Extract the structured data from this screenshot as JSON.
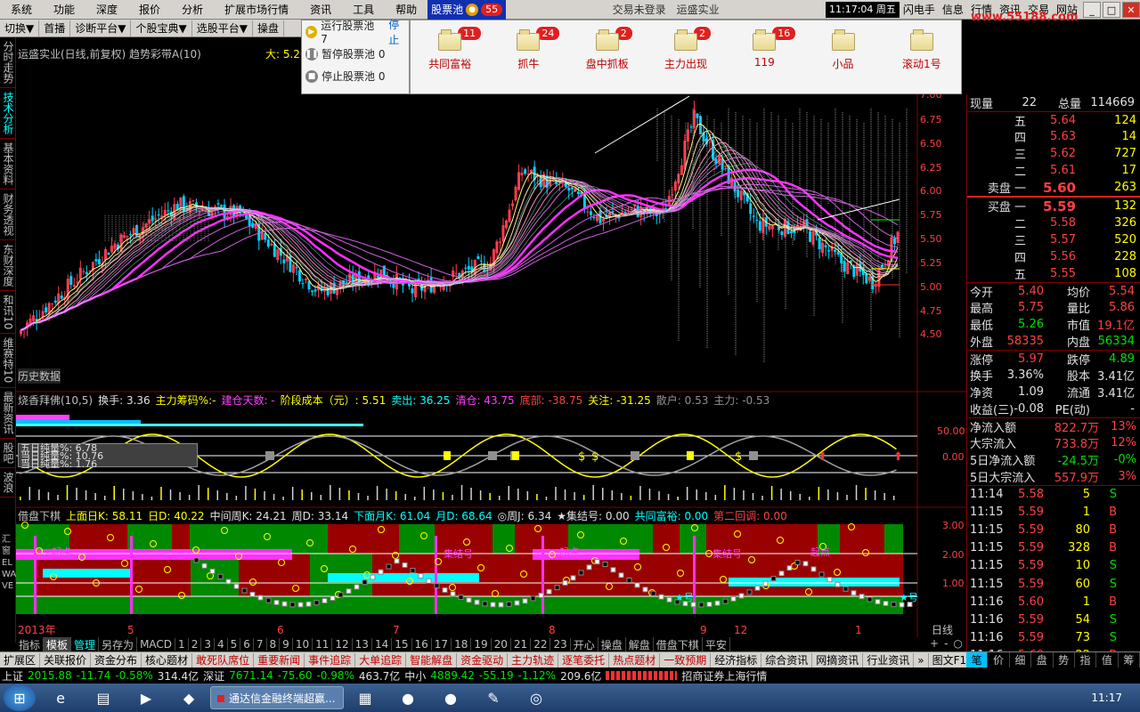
{
  "menu": {
    "items": [
      "系统",
      "功能",
      "深度",
      "报价",
      "分析",
      "扩展市场行情",
      "资讯",
      "工具",
      "帮助"
    ],
    "pool_label": "股票池",
    "pool_count": "55",
    "title": "交易未登录　运盛实业",
    "clock": "11:17:04 周五",
    "right_items": [
      "闪电手",
      "信息",
      "行情",
      "资讯",
      "交易",
      "网站"
    ],
    "site": "www.55188.com"
  },
  "toolbar": {
    "items": [
      "切换▼",
      "首播",
      "诊断平台▼",
      "个股宝典▼",
      "选股平台▼",
      "操盘"
    ]
  },
  "lefttabs": [
    "分时走势",
    "技术分析",
    "基本资料",
    "财务透视",
    "东财深度",
    "和讯10",
    "维赛特10",
    "最新资讯",
    "股吧",
    "波浪"
  ],
  "chart_header": {
    "title": "运盛实业(日线,前复权) 趋势彩带A(10)",
    "max_label": "大: 5.26",
    "data_label": "历史数据",
    "axis_prices": [
      "7.00",
      "6.75",
      "6.50",
      "6.25",
      "6.00",
      "5.75",
      "5.50",
      "5.25",
      "5.00",
      "4.75",
      "4.50"
    ]
  },
  "pool_menu": {
    "items": [
      "运行股票池 7",
      "暂停股票池 0",
      "停止股票池 0"
    ],
    "stop_label": "停止"
  },
  "pools": [
    {
      "name": "共同富裕",
      "count": "11"
    },
    {
      "name": "抓牛",
      "count": "24"
    },
    {
      "name": "盘中抓板",
      "count": "2"
    },
    {
      "name": "主力出现",
      "count": "2"
    },
    {
      "name": "119",
      "count": "16"
    },
    {
      "name": "小品",
      "count": ""
    },
    {
      "name": "滚动1号",
      "count": ""
    }
  ],
  "ind1": {
    "label": "烧香拜佛(10,5)",
    "items": [
      {
        "t": "换手: 3.36",
        "c": "wht"
      },
      {
        "t": "主力筹码%:-",
        "c": "yel"
      },
      {
        "t": "建仓天数: -",
        "c": "mag"
      },
      {
        "t": "阶段成本（元）: 5.51",
        "c": "yel"
      },
      {
        "t": "卖出: 36.25",
        "c": "cyn"
      },
      {
        "t": "清仓: 43.75",
        "c": "mag"
      },
      {
        "t": "底部: -38.75",
        "c": "red"
      },
      {
        "t": "关注: -31.25",
        "c": "yel"
      },
      {
        "t": "散户: 0.53",
        "c": "gry"
      },
      {
        "t": "主力: -0.53",
        "c": "gry"
      }
    ],
    "box": [
      "五日纯量%: 6.78",
      "当日纯量%: 10.76",
      "当日纯量%: 1.76"
    ],
    "axis": [
      "50.00",
      "0.00"
    ]
  },
  "ind2": {
    "label": "借盘下棋",
    "items": [
      {
        "t": "上面日K: 58.11",
        "c": "yel"
      },
      {
        "t": "日D: 40.22",
        "c": "yel"
      },
      {
        "t": "中间周K: 24.21",
        "c": "wht"
      },
      {
        "t": "周D: 33.14",
        "c": "wht"
      },
      {
        "t": "下面月K: 61.04",
        "c": "cyn"
      },
      {
        "t": "月D: 68.64",
        "c": "cyn"
      },
      {
        "t": "◎周J: 6.34",
        "c": "wht"
      },
      {
        "t": "★集结号: 0.00",
        "c": "wht"
      },
      {
        "t": "共同富裕: 0.00",
        "c": "cyn"
      },
      {
        "t": "第二回调: 0.00",
        "c": "red"
      }
    ],
    "axis": [
      "3.00",
      "2.00",
      "1.00"
    ],
    "left_labels": [
      "汇",
      "窗",
      "EL",
      "WA",
      "VE"
    ],
    "markers": [
      "集结号",
      "集结号",
      "起点",
      "起点",
      "起点",
      "★号",
      "★号"
    ]
  },
  "xaxis": {
    "labels": [
      "2013年",
      "5",
      "6",
      "7",
      "8",
      "9",
      "12",
      "1"
    ],
    "period": "日线"
  },
  "quote": {
    "current_label": "现量",
    "current": "22",
    "total_label": "总量",
    "total": "114669",
    "asks": [
      {
        "n": "五",
        "p": "5.64",
        "v": "124"
      },
      {
        "n": "四",
        "p": "5.63",
        "v": "14"
      },
      {
        "n": "三",
        "p": "5.62",
        "v": "727"
      },
      {
        "n": "二",
        "p": "5.61",
        "v": "17"
      },
      {
        "n": "卖盘 一",
        "p": "5.60",
        "v": "263"
      }
    ],
    "bids": [
      {
        "n": "买盘 一",
        "p": "5.59",
        "v": "132"
      },
      {
        "n": "二",
        "p": "5.58",
        "v": "326"
      },
      {
        "n": "三",
        "p": "5.57",
        "v": "520"
      },
      {
        "n": "四",
        "p": "5.56",
        "v": "228"
      },
      {
        "n": "五",
        "p": "5.55",
        "v": "108"
      }
    ],
    "stats": [
      [
        "今开",
        "5.40",
        "均价",
        "5.54"
      ],
      [
        "最高",
        "5.75",
        "量比",
        "5.86"
      ],
      [
        "最低",
        "5.26",
        "市值",
        "19.1亿"
      ],
      [
        "外盘",
        "58335",
        "内盘",
        "56334"
      ],
      [
        "涨停",
        "5.97",
        "跌停",
        "4.89"
      ],
      [
        "换手",
        "3.36%",
        "股本",
        "3.41亿"
      ],
      [
        "净资",
        "1.09",
        "流通",
        "3.41亿"
      ],
      [
        "收益(三)",
        "-0.08",
        "PE(动)",
        "-"
      ]
    ],
    "flows": [
      [
        "净流入额",
        "822.7万",
        "13%"
      ],
      [
        "大宗流入",
        "733.8万",
        "12%"
      ],
      [
        "5日净流入额",
        "-24.5万",
        "-0%"
      ],
      [
        "5日大宗流入",
        "557.9万",
        "3%"
      ]
    ],
    "ticks": [
      [
        "11:14",
        "5.58",
        "5",
        "S"
      ],
      [
        "11:15",
        "5.59",
        "1",
        "B"
      ],
      [
        "11:15",
        "5.59",
        "80",
        "B"
      ],
      [
        "11:15",
        "5.59",
        "328",
        "B"
      ],
      [
        "11:15",
        "5.59",
        "10",
        "S"
      ],
      [
        "11:15",
        "5.59",
        "60",
        "S"
      ],
      [
        "11:16",
        "5.60",
        "1",
        "B"
      ],
      [
        "11:16",
        "5.59",
        "54",
        "S"
      ],
      [
        "11:16",
        "5.59",
        "73",
        "S"
      ],
      [
        "11:16",
        "5.60",
        "22",
        "B"
      ]
    ]
  },
  "btabs1": [
    "指标",
    "模板",
    "管理",
    "另存为",
    "MACD",
    "1",
    "2",
    "3",
    "4",
    "5",
    "6",
    "7",
    "8",
    "9",
    "10",
    "11",
    "12",
    "13",
    "14",
    "15",
    "16",
    "17",
    "18",
    "19",
    "20",
    "21",
    "22",
    "23",
    "开心",
    "操盘",
    "解盘",
    "借盘下棋",
    "平安"
  ],
  "btabs2": [
    "扩展区",
    "关联报价",
    "资金分布",
    "核心题材",
    "敢死队席位",
    "重要新闻",
    "事件追踪",
    "大单追踪",
    "智能解盘",
    "资金驱动",
    "主力轨迹",
    "逐笔委托",
    "热点题材",
    "一致预期",
    "经济指标",
    "综合资讯",
    "网摘资讯",
    "行业资讯",
    "»",
    "图文F10"
  ],
  "rtabs": [
    "笔",
    "价",
    "细",
    "盘",
    "势",
    "指",
    "值",
    "筹"
  ],
  "status": [
    {
      "t": "上证",
      "c": "wht"
    },
    {
      "t": "2015.88",
      "c": "grn"
    },
    {
      "t": "-11.74",
      "c": "grn"
    },
    {
      "t": "-0.58%",
      "c": "grn"
    },
    {
      "t": "314.4亿",
      "c": "wht"
    },
    {
      "t": "深证",
      "c": "wht"
    },
    {
      "t": "7671.14",
      "c": "grn"
    },
    {
      "t": "-75.60",
      "c": "grn"
    },
    {
      "t": "-0.98%",
      "c": "grn"
    },
    {
      "t": "463.7亿",
      "c": "wht"
    },
    {
      "t": "中小",
      "c": "wht"
    },
    {
      "t": "4889.42",
      "c": "grn"
    },
    {
      "t": "-55.19",
      "c": "grn"
    },
    {
      "t": "-1.12%",
      "c": "grn"
    },
    {
      "t": "209.6亿",
      "c": "wht"
    },
    {
      "t": "招商证券上海行情",
      "c": "wht"
    }
  ],
  "taskbar": {
    "window": "通达信金融终端超赢...",
    "time": "11:17"
  }
}
